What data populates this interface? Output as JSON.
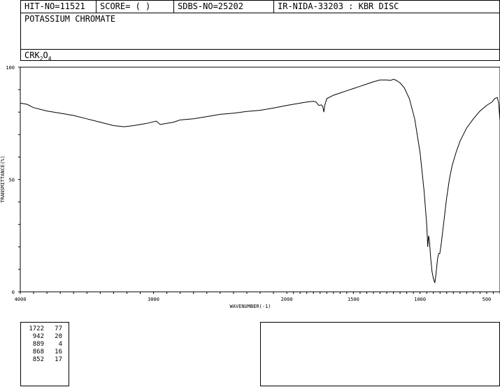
{
  "header": {
    "hit_no": "HIT-NO=11521",
    "score": "SCORE=  (   )",
    "sdbs_no": "SDBS-NO=25202",
    "ir_info": "IR-NIDA-33203 : KBR DISC",
    "compound_name": "POTASSIUM CHROMATE",
    "formula_parts": [
      "CRK",
      "2",
      "O",
      "4"
    ]
  },
  "chart_data": {
    "type": "line",
    "xlabel": "WAVENUMBER(-1)",
    "ylabel": "TRANSMITTANCE(%)",
    "xlim": [
      4000,
      400
    ],
    "ylim": [
      0,
      100
    ],
    "x_ticks": [
      4000,
      3000,
      2000,
      1500,
      1000,
      500
    ],
    "x_tick_labels": [
      "4000",
      "3000",
      "2000",
      "1500",
      "1000",
      "500"
    ],
    "y_ticks": [
      0,
      50,
      100
    ],
    "y_tick_labels": [
      "0",
      "50",
      "100"
    ],
    "series": [
      {
        "points": [
          [
            4000,
            84
          ],
          [
            3950,
            83.5
          ],
          [
            3900,
            82
          ],
          [
            3800,
            80.5
          ],
          [
            3700,
            79.5
          ],
          [
            3600,
            78.5
          ],
          [
            3500,
            77
          ],
          [
            3400,
            75.5
          ],
          [
            3300,
            74
          ],
          [
            3220,
            73.5
          ],
          [
            3150,
            74
          ],
          [
            3050,
            75
          ],
          [
            2980,
            76
          ],
          [
            2950,
            74.5
          ],
          [
            2900,
            75
          ],
          [
            2850,
            75.5
          ],
          [
            2800,
            76.5
          ],
          [
            2700,
            77
          ],
          [
            2600,
            78
          ],
          [
            2500,
            79
          ],
          [
            2400,
            79.5
          ],
          [
            2300,
            80.3
          ],
          [
            2200,
            80.8
          ],
          [
            2100,
            81.8
          ],
          [
            2000,
            83
          ],
          [
            1950,
            83.5
          ],
          [
            1900,
            84
          ],
          [
            1850,
            84.5
          ],
          [
            1800,
            84.8
          ],
          [
            1780,
            84.5
          ],
          [
            1760,
            83
          ],
          [
            1740,
            83.2
          ],
          [
            1730,
            82.5
          ],
          [
            1722,
            80
          ],
          [
            1715,
            83
          ],
          [
            1700,
            86
          ],
          [
            1650,
            87.5
          ],
          [
            1600,
            88.5
          ],
          [
            1550,
            89.5
          ],
          [
            1500,
            90.5
          ],
          [
            1450,
            91.5
          ],
          [
            1400,
            92.5
          ],
          [
            1350,
            93.5
          ],
          [
            1300,
            94.3
          ],
          [
            1250,
            94.3
          ],
          [
            1220,
            94.1
          ],
          [
            1200,
            94.6
          ],
          [
            1180,
            94.2
          ],
          [
            1150,
            93
          ],
          [
            1120,
            91
          ],
          [
            1080,
            86
          ],
          [
            1040,
            77
          ],
          [
            1000,
            62
          ],
          [
            970,
            45
          ],
          [
            950,
            30
          ],
          [
            945,
            24
          ],
          [
            942,
            20
          ],
          [
            936,
            25
          ],
          [
            930,
            23
          ],
          [
            920,
            15
          ],
          [
            910,
            9
          ],
          [
            900,
            6
          ],
          [
            889,
            4
          ],
          [
            880,
            8
          ],
          [
            868,
            15
          ],
          [
            860,
            17
          ],
          [
            852,
            17
          ],
          [
            840,
            22
          ],
          [
            820,
            32
          ],
          [
            800,
            42
          ],
          [
            780,
            50
          ],
          [
            760,
            56
          ],
          [
            730,
            62
          ],
          [
            700,
            67
          ],
          [
            650,
            73
          ],
          [
            600,
            77
          ],
          [
            550,
            80.5
          ],
          [
            500,
            83
          ],
          [
            460,
            84.5
          ],
          [
            440,
            86
          ],
          [
            420,
            86.5
          ],
          [
            410,
            84
          ],
          [
            400,
            76
          ]
        ]
      }
    ]
  },
  "peak_table": [
    {
      "wavenumber": "1722",
      "transmittance": "77"
    },
    {
      "wavenumber": "942",
      "transmittance": "20"
    },
    {
      "wavenumber": "889",
      "transmittance": "4"
    },
    {
      "wavenumber": "868",
      "transmittance": "16"
    },
    {
      "wavenumber": "852",
      "transmittance": "17"
    }
  ]
}
